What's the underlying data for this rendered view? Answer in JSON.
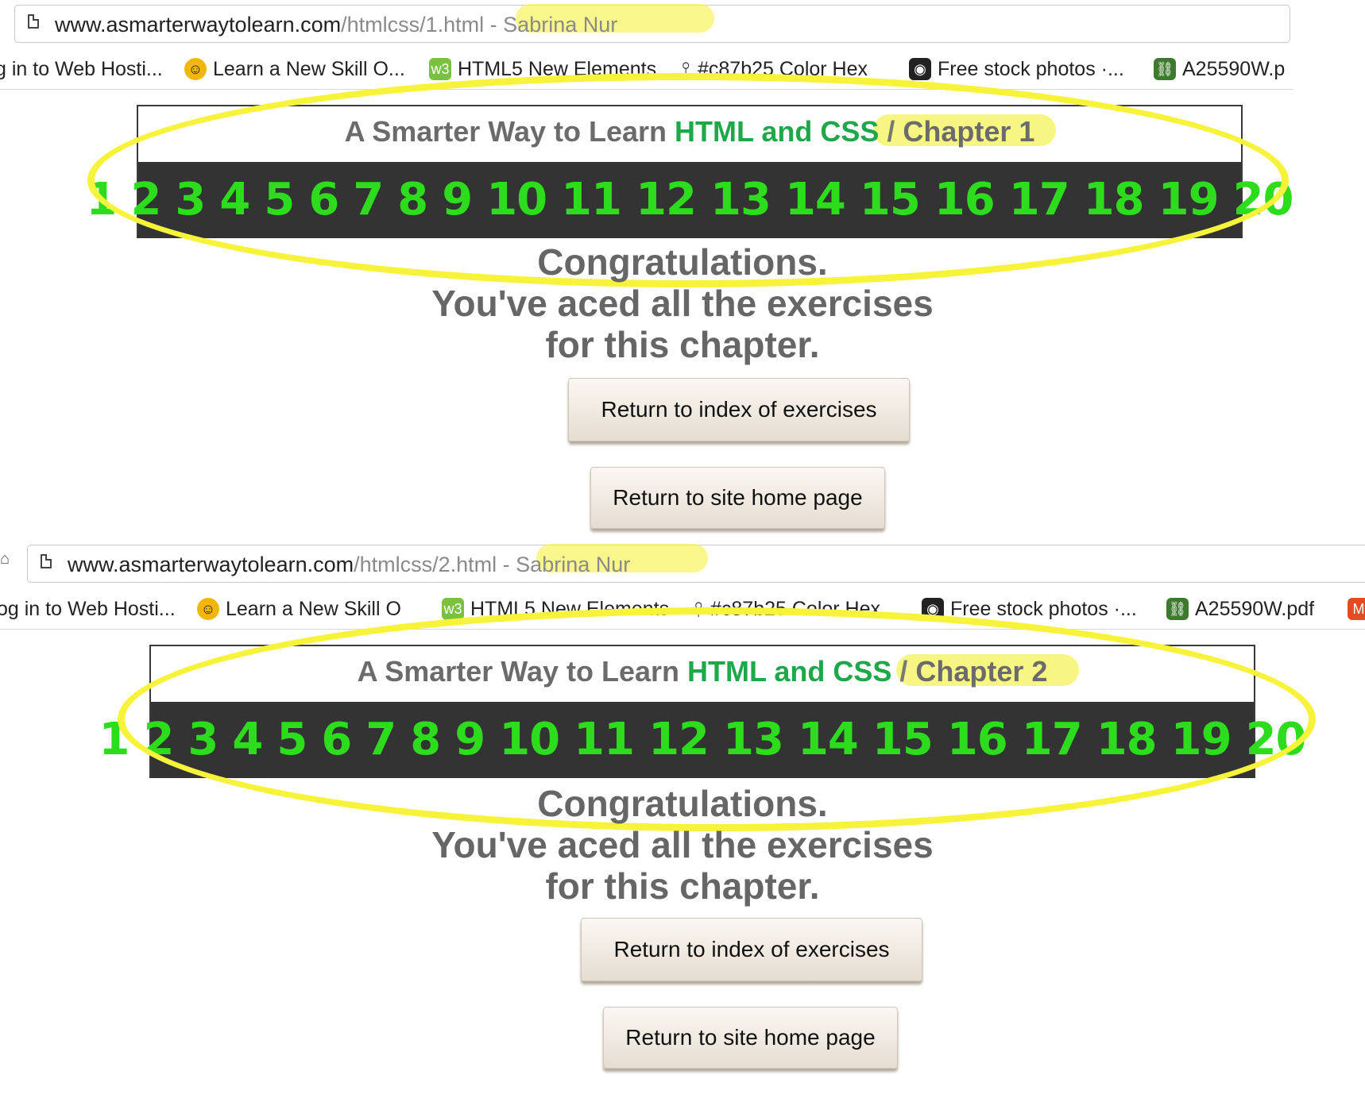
{
  "screens": [
    {
      "url": {
        "domain": "www.asmarterwaytolearn.com",
        "path": "/htmlcss/1.html",
        "title": " - Sabrina Nur"
      },
      "bookmarks": [
        {
          "label": "g in to Web Hosti...",
          "icon": "hostgator-icon"
        },
        {
          "label": "Learn a New Skill O...",
          "icon": "learn-icon"
        },
        {
          "label": "HTML5 New Elements",
          "icon": "w3-icon"
        },
        {
          "label": "#c87b25 Color Hex",
          "icon": "pin-icon"
        },
        {
          "label": "Free stock photos ·...",
          "icon": "camera-icon"
        },
        {
          "label": "A25590W.p",
          "icon": "chain-icon"
        }
      ],
      "header": {
        "prefix": "A Smarter Way to Learn ",
        "subject": "HTML and CSS",
        "separator": "/",
        "chapter": "Chapter 1"
      },
      "numbers": [
        "1",
        "2",
        "3",
        "4",
        "5",
        "6",
        "7",
        "8",
        "9",
        "10",
        "11",
        "12",
        "13",
        "14",
        "15",
        "16",
        "17",
        "18",
        "19",
        "20"
      ],
      "message": [
        "Congratulations.",
        "You've aced all the exercises",
        "for this chapter."
      ],
      "buttons": {
        "index": "Return to index of exercises",
        "home": "Return to site home page"
      }
    },
    {
      "url": {
        "domain": "www.asmarterwaytolearn.com",
        "path": "/htmlcss/2.html",
        "title": " - Sabrina Nur"
      },
      "bookmarks": [
        {
          "label": "og in to Web Hosti...",
          "icon": "hostgator-icon"
        },
        {
          "label": "Learn a New Skill O",
          "icon": "learn-icon"
        },
        {
          "label": "HTML5 New Elements",
          "icon": "w3-icon"
        },
        {
          "label": "#c87b25 Color Hex",
          "icon": "pin-icon"
        },
        {
          "label": "Free stock photos ·...",
          "icon": "camera-icon"
        },
        {
          "label": "A25590W.pdf",
          "icon": "chain-icon"
        },
        {
          "label": "",
          "icon": "magento-icon"
        }
      ],
      "header": {
        "prefix": "A Smarter Way to Learn ",
        "subject": "HTML and CSS",
        "separator": "/",
        "chapter": "Chapter 2"
      },
      "numbers": [
        "1",
        "2",
        "3",
        "4",
        "5",
        "6",
        "7",
        "8",
        "9",
        "10",
        "11",
        "12",
        "13",
        "14",
        "15",
        "16",
        "17",
        "18",
        "19",
        "20"
      ],
      "message": [
        "Congratulations.",
        "You've aced all the exercises",
        "for this chapter."
      ],
      "buttons": {
        "index": "Return to index of exercises",
        "home": "Return to site home page"
      }
    }
  ],
  "colors": {
    "accent_green": "#1ea84a",
    "number_green": "#2edc1e",
    "bar_dark": "#333333",
    "highlight_yellow": "#f7f33a"
  }
}
